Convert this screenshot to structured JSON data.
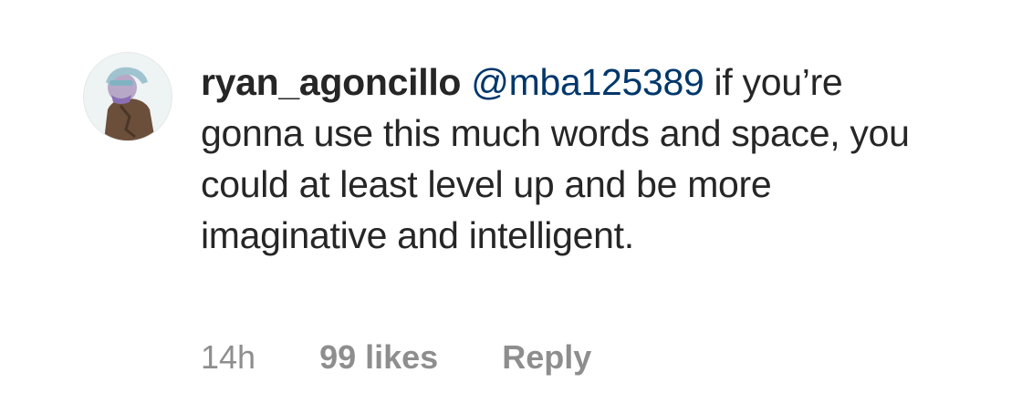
{
  "comment": {
    "username": "ryan_agoncillo",
    "mention": "@mba125389",
    "text": " if you’re gonna use this much words and space, you could at least level up and be more imaginative and intelligent.",
    "time": "14h",
    "likes": "99 likes",
    "reply_label": "Reply"
  },
  "avatar": {
    "icon": "user-avatar-icon",
    "background_color": "#eef3f4",
    "accent_color": "#6b4f3a"
  },
  "colors": {
    "text": "#262626",
    "mention": "#00376b",
    "meta": "#8e8e8e"
  }
}
